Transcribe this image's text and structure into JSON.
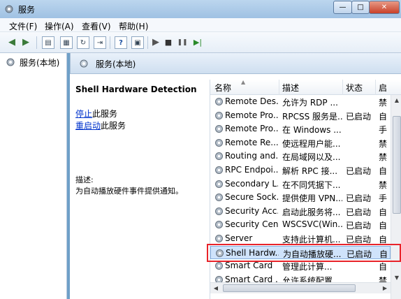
{
  "window": {
    "title": "服务",
    "min_glyph": "—",
    "max_glyph": "□",
    "close_glyph": "✕"
  },
  "menu": [
    "文件(F)",
    "操作(A)",
    "查看(V)",
    "帮助(H)"
  ],
  "toolbar": {
    "back": "◀",
    "forward": "▶",
    "help": "?",
    "play": "▶",
    "stop": "■",
    "pause": "❚❚",
    "restart": "▶|"
  },
  "tree": {
    "root_label": "服务(本地)"
  },
  "pane": {
    "header": "服务(本地)",
    "service_title": "Shell Hardware Detection",
    "stop_link": "停止",
    "stop_suffix": "此服务",
    "restart_link": "重启动",
    "restart_suffix": "此服务",
    "desc_label": "描述:",
    "desc_text": "为自动播放硬件事件提供通知。"
  },
  "columns": {
    "name": "名称",
    "desc": "描述",
    "status": "状态",
    "start": "启"
  },
  "services": [
    {
      "name": "Remote Des...",
      "desc": "允许为 RDP ...",
      "status": "",
      "start": "禁"
    },
    {
      "name": "Remote Pro...",
      "desc": "RPCSS 服务是...",
      "status": "已启动",
      "start": "自"
    },
    {
      "name": "Remote Pro...",
      "desc": "在 Windows ...",
      "status": "",
      "start": "手"
    },
    {
      "name": "Remote Re...",
      "desc": "使远程用户能...",
      "status": "",
      "start": "禁"
    },
    {
      "name": "Routing and...",
      "desc": "在局域网以及...",
      "status": "",
      "start": "禁"
    },
    {
      "name": "RPC Endpoi...",
      "desc": "解析 RPC 接...",
      "status": "已启动",
      "start": "自"
    },
    {
      "name": "Secondary L...",
      "desc": "在不同凭据下...",
      "status": "",
      "start": "禁"
    },
    {
      "name": "Secure Sock...",
      "desc": "提供使用 VPN...",
      "status": "已启动",
      "start": "手"
    },
    {
      "name": "Security Acc...",
      "desc": "启动此服务将...",
      "status": "已启动",
      "start": "自"
    },
    {
      "name": "Security Cen...",
      "desc": "WSCSVC(Win...",
      "status": "已启动",
      "start": "自"
    },
    {
      "name": "Server",
      "desc": "支持此计算机...",
      "status": "已启动",
      "start": "自"
    },
    {
      "name": "Shell Hardw...",
      "desc": "为自动播放硬...",
      "status": "已启动",
      "start": "自"
    },
    {
      "name": "Smart Card",
      "desc": "管理此计算...",
      "status": "",
      "start": "自"
    },
    {
      "name": "Smart Card ...",
      "desc": "允许系统配置...",
      "status": "",
      "start": "禁"
    }
  ],
  "selected_index": 11,
  "colors": {
    "link": "#0033cc",
    "highlight": "#e8232a",
    "selection": "#cfe3fb"
  }
}
